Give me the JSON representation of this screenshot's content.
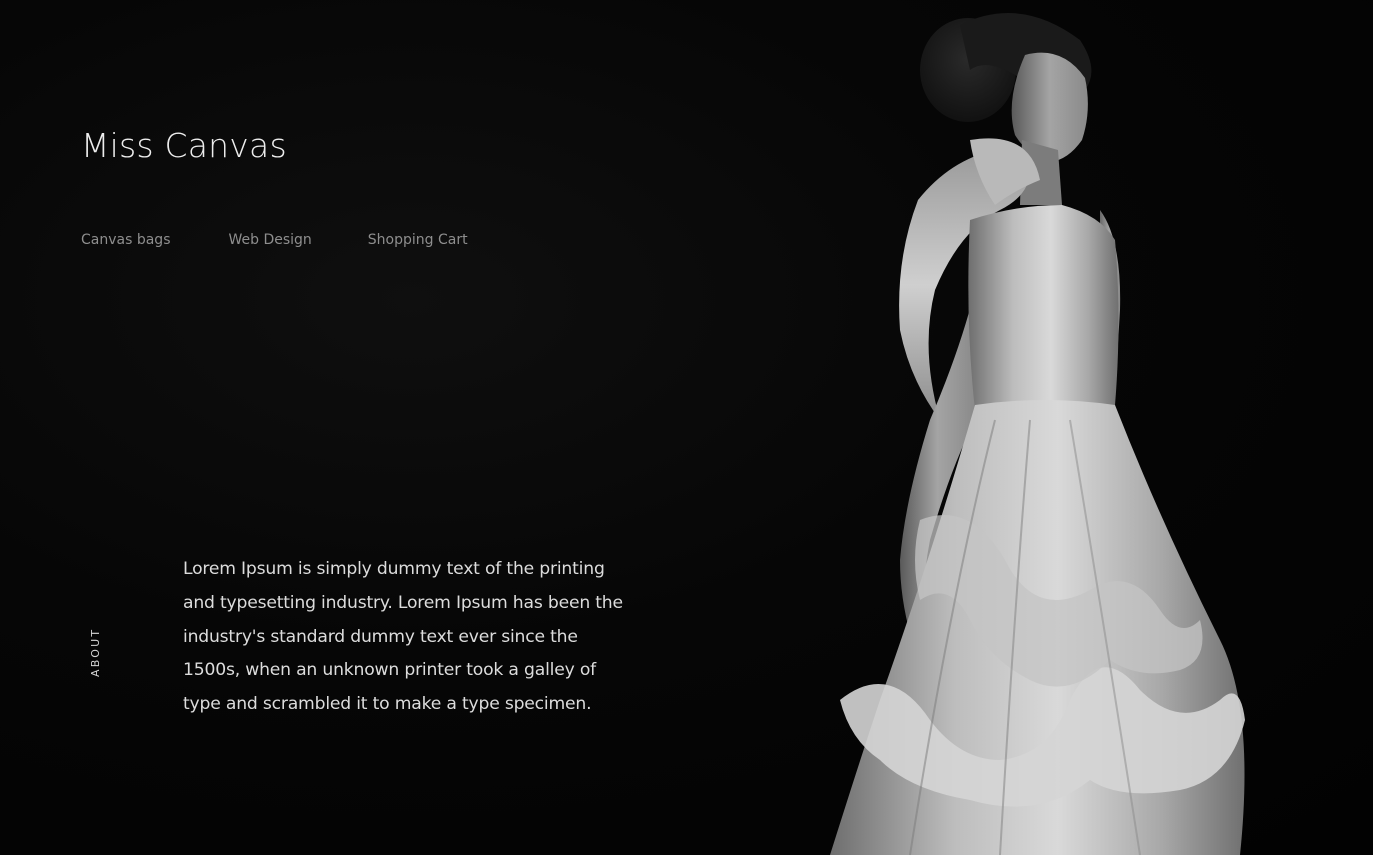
{
  "header": {
    "brand": "Miss Canvas"
  },
  "nav": {
    "items": [
      {
        "label": "Canvas bags"
      },
      {
        "label": "Web Design"
      },
      {
        "label": "Shopping Cart"
      }
    ]
  },
  "about": {
    "label": "ABOUT",
    "text": "Lorem Ipsum is simply dummy text of the printing and typesetting industry. Lorem Ipsum has been the industry's standard dummy text ever since the 1500s, when an unknown printer took a galley of type and scrambled it to make a type specimen."
  },
  "hero": {
    "image": "woman-in-white-gown-photo"
  },
  "colors": {
    "background": "#000000",
    "brand_text": "#ededed",
    "nav_text": "#8e8e8e",
    "body_text": "#dcdcdc"
  }
}
